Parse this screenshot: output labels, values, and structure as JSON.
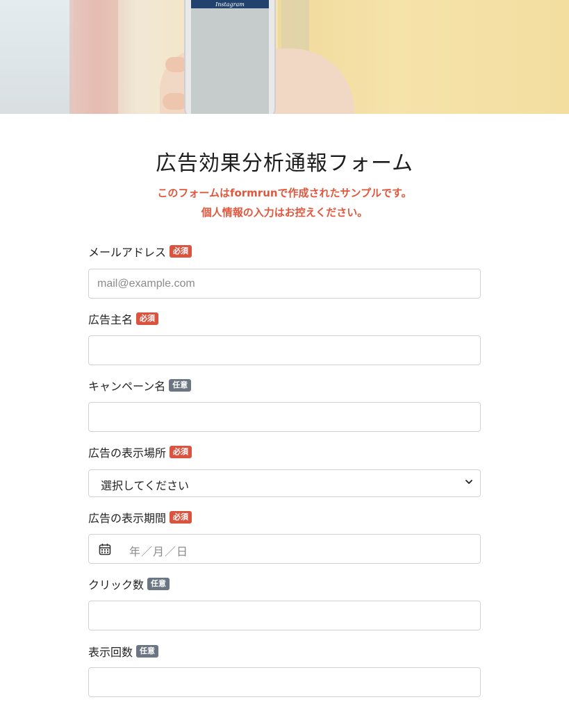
{
  "hero": {
    "phone_app_name": "Instagram"
  },
  "form": {
    "title": "広告効果分析通報フォーム",
    "notice_line1": "このフォームはformrunで作成されたサンプルです。",
    "notice_line2": "個人情報の入力はお控えください。",
    "badges": {
      "required": "必須",
      "optional": "任意"
    },
    "fields": [
      {
        "label": "メールアドレス",
        "badge": "必須",
        "placeholder": "mail@example.com",
        "value": ""
      },
      {
        "label": "広告主名",
        "badge": "必須",
        "placeholder": "",
        "value": ""
      },
      {
        "label": "キャンペーン名",
        "badge": "任意",
        "placeholder": "",
        "value": ""
      },
      {
        "label": "広告の表示場所",
        "badge": "必須",
        "selected": "選択してください"
      },
      {
        "label": "広告の表示期間",
        "badge": "必須",
        "date_placeholder": "年／月／日"
      },
      {
        "label": "クリック数",
        "badge": "任意",
        "placeholder": "",
        "value": ""
      },
      {
        "label": "表示回数",
        "badge": "任意",
        "placeholder": "",
        "value": ""
      }
    ]
  },
  "colors": {
    "accent": "#e0573e",
    "required_badge": "#d9533e",
    "optional_badge": "#6b7682",
    "input_border": "#cfd3d7"
  },
  "icons": {
    "select": "chevron-down-icon",
    "date": "calendar-icon"
  }
}
